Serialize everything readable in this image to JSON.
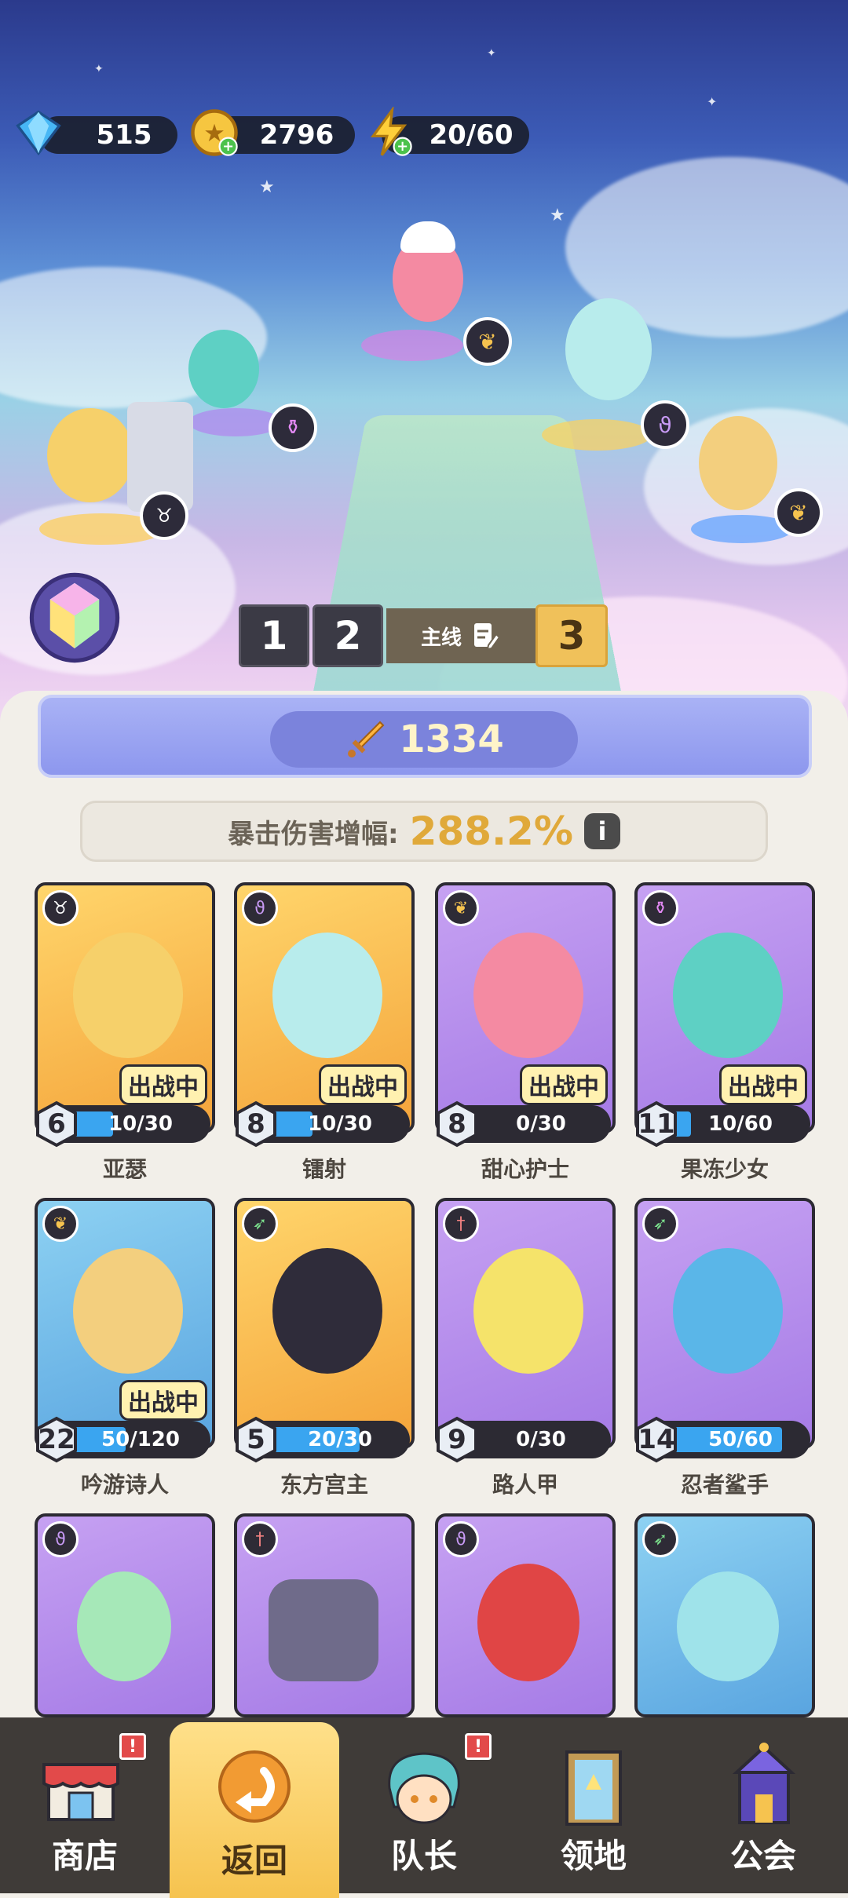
{
  "resources": {
    "gems": "515",
    "gold": "2796",
    "energy": "20/60"
  },
  "stage": {
    "left": "1",
    "middle": "2",
    "mode_label": "主线",
    "current": "3"
  },
  "power": "1334",
  "crit": {
    "label": "暴击伤害增幅:",
    "value": "288.2%",
    "info_icon": "i"
  },
  "status_tag": "出战中",
  "heroes": [
    {
      "name": "亚瑟",
      "level": "6",
      "progress": "10/30",
      "progress_fraction": 0.33,
      "in_battle": true,
      "class_icon": "bull-icon",
      "frame": "gold"
    },
    {
      "name": "镭射",
      "level": "8",
      "progress": "10/30",
      "progress_fraction": 0.33,
      "in_battle": true,
      "class_icon": "swirl-icon",
      "frame": "gold"
    },
    {
      "name": "甜心护士",
      "level": "8",
      "progress": "0/30",
      "progress_fraction": 0.0,
      "in_battle": true,
      "class_icon": "wings-icon",
      "frame": "purple"
    },
    {
      "name": "果冻少女",
      "level": "11",
      "progress": "10/60",
      "progress_fraction": 0.17,
      "in_battle": true,
      "class_icon": "potion-icon",
      "frame": "purple"
    },
    {
      "name": "吟游诗人",
      "level": "22",
      "progress": "50/120",
      "progress_fraction": 0.42,
      "in_battle": true,
      "class_icon": "wings-icon",
      "frame": "blue"
    },
    {
      "name": "东方宫主",
      "level": "5",
      "progress": "20/30",
      "progress_fraction": 0.67,
      "in_battle": false,
      "class_icon": "bow-icon",
      "frame": "gold"
    },
    {
      "name": "路人甲",
      "level": "9",
      "progress": "0/30",
      "progress_fraction": 0.0,
      "in_battle": false,
      "class_icon": "sword-icon",
      "frame": "purple"
    },
    {
      "name": "忍者鲨手",
      "level": "14",
      "progress": "50/60",
      "progress_fraction": 0.83,
      "in_battle": false,
      "class_icon": "bow-icon",
      "frame": "purple"
    }
  ],
  "nav": {
    "shop": "商店",
    "back": "返回",
    "captain": "队长",
    "territory": "领地",
    "guild": "公会",
    "alert_mark": "!"
  },
  "colors": {
    "accent_gold": "#f6c34f",
    "bar_blue": "#3aa5f0",
    "crit_value": "#e0a93a",
    "power_bar": "#8d97ee"
  }
}
